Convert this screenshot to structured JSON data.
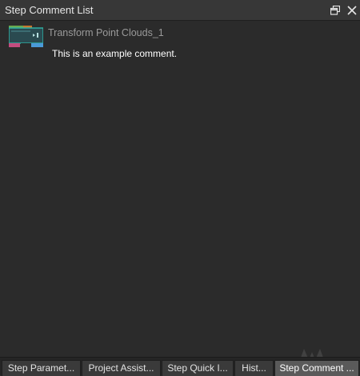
{
  "window": {
    "title": "Step Comment List",
    "float_icon": "float-window-icon",
    "close_icon": "close-icon"
  },
  "comments": [
    {
      "step_name": "Transform Point Clouds_1",
      "step_icon": "transform-point-clouds-step-icon",
      "text": "This is an example comment."
    }
  ],
  "tabs": [
    {
      "label": "Step Paramet...",
      "active": false
    },
    {
      "label": "Project Assist...",
      "active": false
    },
    {
      "label": "Step Quick I...",
      "active": false
    },
    {
      "label": "Hist...",
      "active": false
    },
    {
      "label": "Step Comment ...",
      "active": true
    }
  ],
  "colors": {
    "background": "#2b2b2b",
    "titlebar": "#373737",
    "active_tab": "#5a5a5a",
    "tab": "#3a3a3a"
  }
}
